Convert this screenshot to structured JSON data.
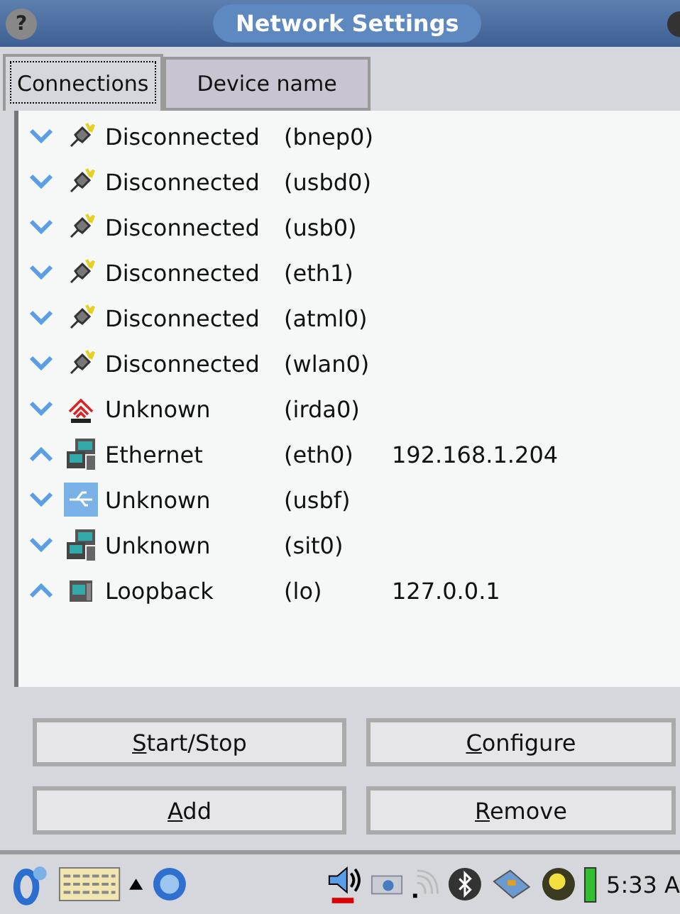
{
  "window": {
    "title": "Network Settings",
    "help": "?"
  },
  "tabs": [
    {
      "label": "Connections",
      "selected": true
    },
    {
      "label": "Device name",
      "selected": false
    }
  ],
  "connections": [
    {
      "kind": "disconnected",
      "up": false,
      "status": "Disconnected",
      "device": "(bnep0)"
    },
    {
      "kind": "disconnected",
      "up": false,
      "status": "Disconnected",
      "device": "(usbd0)"
    },
    {
      "kind": "disconnected",
      "up": false,
      "status": "Disconnected",
      "device": "(usb0)"
    },
    {
      "kind": "disconnected",
      "up": false,
      "status": "Disconnected",
      "device": "(eth1)"
    },
    {
      "kind": "disconnected",
      "up": false,
      "status": "Disconnected",
      "device": "(atml0)"
    },
    {
      "kind": "disconnected",
      "up": false,
      "status": "Disconnected",
      "device": "(wlan0)"
    },
    {
      "kind": "irda",
      "up": false,
      "status": "Unknown",
      "device": "(irda0)"
    },
    {
      "kind": "network",
      "up": true,
      "status": "Ethernet",
      "device": "(eth0)",
      "address": "192.168.1.204"
    },
    {
      "kind": "usb",
      "up": false,
      "status": "Unknown",
      "device": "(usbf)"
    },
    {
      "kind": "network",
      "up": false,
      "status": "Unknown",
      "device": "(sit0)"
    },
    {
      "kind": "loopback",
      "up": true,
      "status": "Loopback",
      "device": "(lo)",
      "address": "127.0.0.1"
    }
  ],
  "buttons": [
    {
      "label": "Start/Stop"
    },
    {
      "label": "Configure"
    },
    {
      "label": "Add"
    },
    {
      "label": "Remove"
    }
  ],
  "taskbar": {
    "clock": "5:33 A"
  }
}
